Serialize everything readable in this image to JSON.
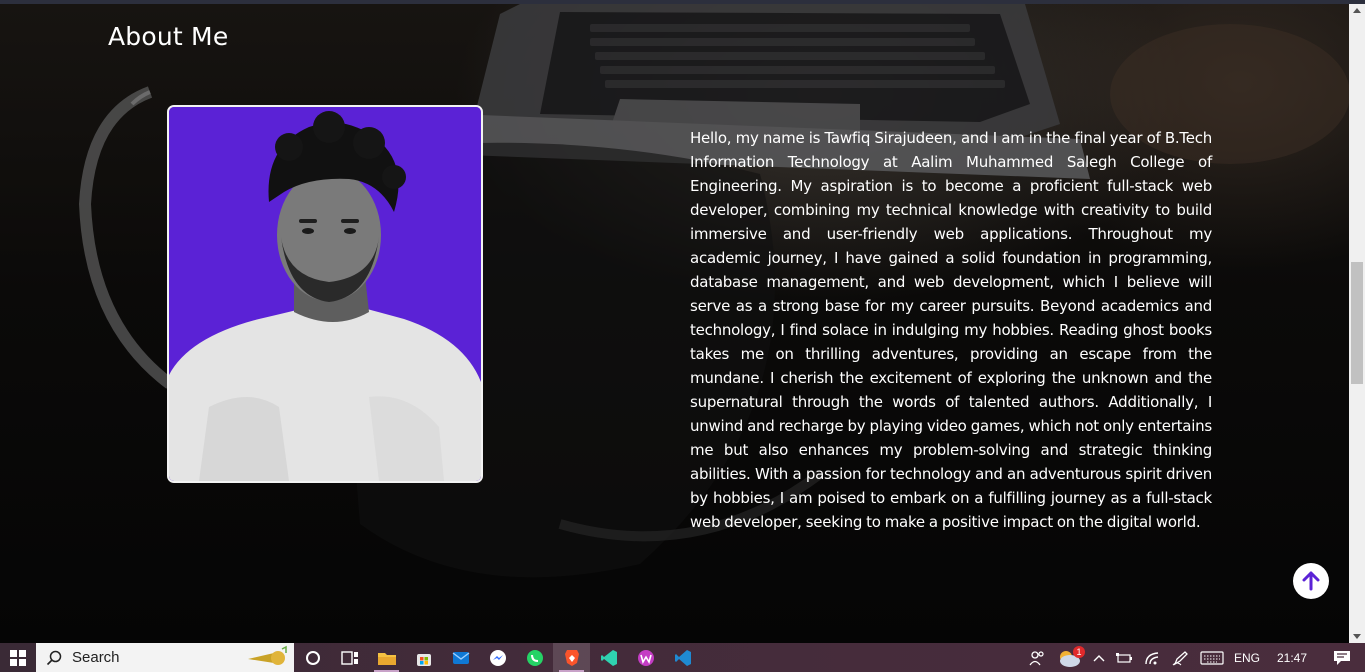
{
  "section": {
    "title": "About Me"
  },
  "about": {
    "paragraph": "Hello, my name is Tawfiq Sirajudeen, and I am in the final year of B.Tech Information Technology at Aalim Muhammed Salegh College of Engineering. My aspiration is to become a proficient full-stack web developer, combining my technical knowledge with creativity to build immersive and user-friendly web applications. Throughout my academic journey, I have gained a solid foundation in programming, database management, and web development, which I believe will serve as a strong base for my career pursuits. Beyond academics and technology, I find solace in indulging my hobbies. Reading ghost books takes me on thrilling adventures, providing an escape from the mundane. I cherish the excitement of exploring the unknown and the supernatural through the words of talented authors. Additionally, I unwind and recharge by playing video games, which not only entertains me but also enhances my problem-solving and strategic thinking abilities. With a passion for technology and an adventurous spirit driven by hobbies, I am poised to embark on a fulfilling journey as a full-stack web developer, seeking to make a positive impact on the digital world."
  },
  "colors": {
    "photo_background": "#5b22d6",
    "scroll_top_arrow": "#5b22d6",
    "text": "#ffffff"
  },
  "icons": {
    "scroll_top": "arrow-up-icon"
  },
  "taskbar": {
    "search_label": "Search",
    "apps": [
      {
        "name": "cortana-icon"
      },
      {
        "name": "task-view-icon"
      },
      {
        "name": "file-explorer-icon"
      },
      {
        "name": "microsoft-store-icon"
      },
      {
        "name": "mail-icon"
      },
      {
        "name": "messenger-icon"
      },
      {
        "name": "whatsapp-icon"
      },
      {
        "name": "brave-browser-icon"
      },
      {
        "name": "visual-studio-icon"
      },
      {
        "name": "browser-w-icon"
      },
      {
        "name": "vscode-icon"
      }
    ],
    "weather_badge": "1",
    "language": "ENG",
    "time": "21:47"
  }
}
